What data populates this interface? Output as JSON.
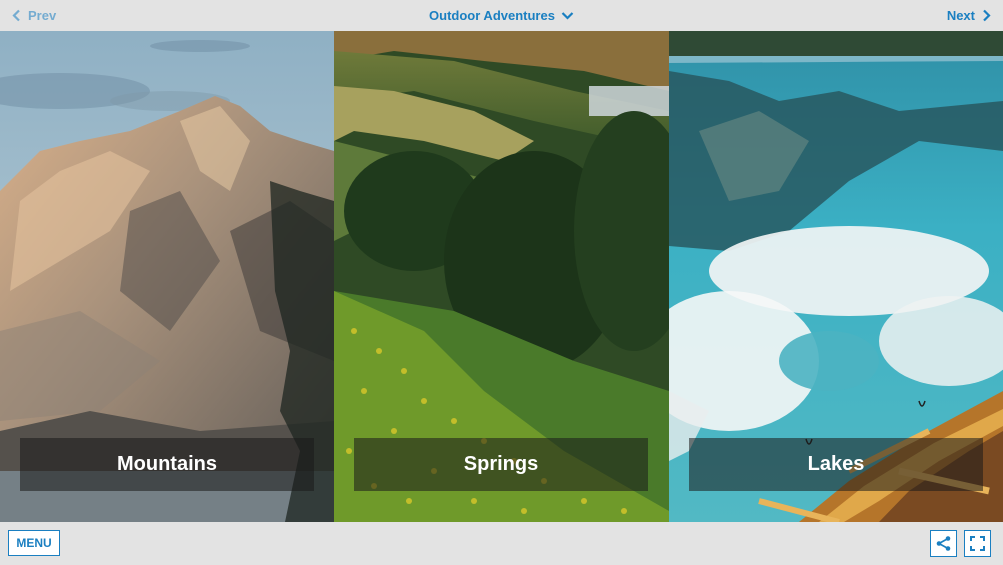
{
  "header": {
    "prev_label": "Prev",
    "title": "Outdoor Adventures",
    "next_label": "Next"
  },
  "panels": [
    {
      "label": "Mountains"
    },
    {
      "label": "Springs"
    },
    {
      "label": "Lakes"
    }
  ],
  "footer": {
    "menu_label": "MENU"
  },
  "colors": {
    "accent": "#1a7fc1",
    "bar_background": "#e3e3e3",
    "caption_background": "rgba(25,25,25,0.55)"
  },
  "icons": {
    "prev": "chevron-left-icon",
    "title": "chevron-down-icon",
    "next": "chevron-right-icon",
    "share": "share-icon",
    "fullscreen": "fullscreen-icon"
  }
}
